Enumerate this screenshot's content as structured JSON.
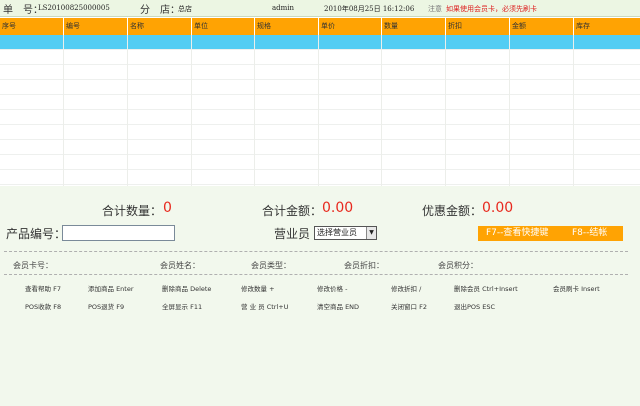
{
  "topbar": {
    "order_label": "单　号：",
    "order_no": "LS20100825000005",
    "branch_label": "分　店：",
    "branch": "总店",
    "user": "admin",
    "datetime": "2010年08月25日 16:12:06",
    "note_label": "注意",
    "note": "如果使用会员卡，必须先刷卡"
  },
  "table": {
    "columns": [
      "序号",
      "编号",
      "名称",
      "单位",
      "规格",
      "单价",
      "数量",
      "折扣",
      "金额",
      "库存"
    ],
    "rows": 11,
    "selected_row": 0
  },
  "summary": {
    "total_qty_label": "合计数量：",
    "total_qty": "0",
    "total_amount_label": "合计金额：",
    "total_amount": "0.00",
    "discount_label": "优惠金额：",
    "discount": "0.00"
  },
  "form": {
    "product_label": "产品编号：",
    "product_value": "",
    "clerk_label": "营业员",
    "clerk_selected": "选择营业员"
  },
  "shortcut_button": {
    "f7": "F7--查看快捷键",
    "f8": "F8--结帐"
  },
  "member": {
    "card_label": "会员卡号：",
    "name_label": "会员姓名：",
    "type_label": "会员类型：",
    "discount_label": "会员折扣：",
    "points_label": "会员积分："
  },
  "hotkeys": [
    [
      "查看帮助",
      "F7"
    ],
    [
      "添加商品",
      "Enter"
    ],
    [
      "删除商品",
      "Delete"
    ],
    [
      "修改数量",
      "+"
    ],
    [
      "修改价格",
      "-"
    ],
    [
      "修改折扣",
      "/"
    ],
    [
      "删除会员",
      "Ctrl+Insert"
    ],
    [
      "会员刷卡",
      "Insert"
    ],
    [
      "POS收款",
      "F8"
    ],
    [
      "POS退货",
      "F9"
    ],
    [
      "全屏显示",
      "F11"
    ],
    [
      "营 业 员",
      "Ctrl+U"
    ],
    [
      "清空商品",
      "END"
    ],
    [
      "关闭窗口",
      "F2"
    ],
    [
      "退出POS",
      "ESC"
    ]
  ],
  "colors": {
    "header_orange": "#ffa303",
    "selected_row": "#53cdf3",
    "amount_red": "#e8291e",
    "panel_green": "#f2f8ed"
  }
}
